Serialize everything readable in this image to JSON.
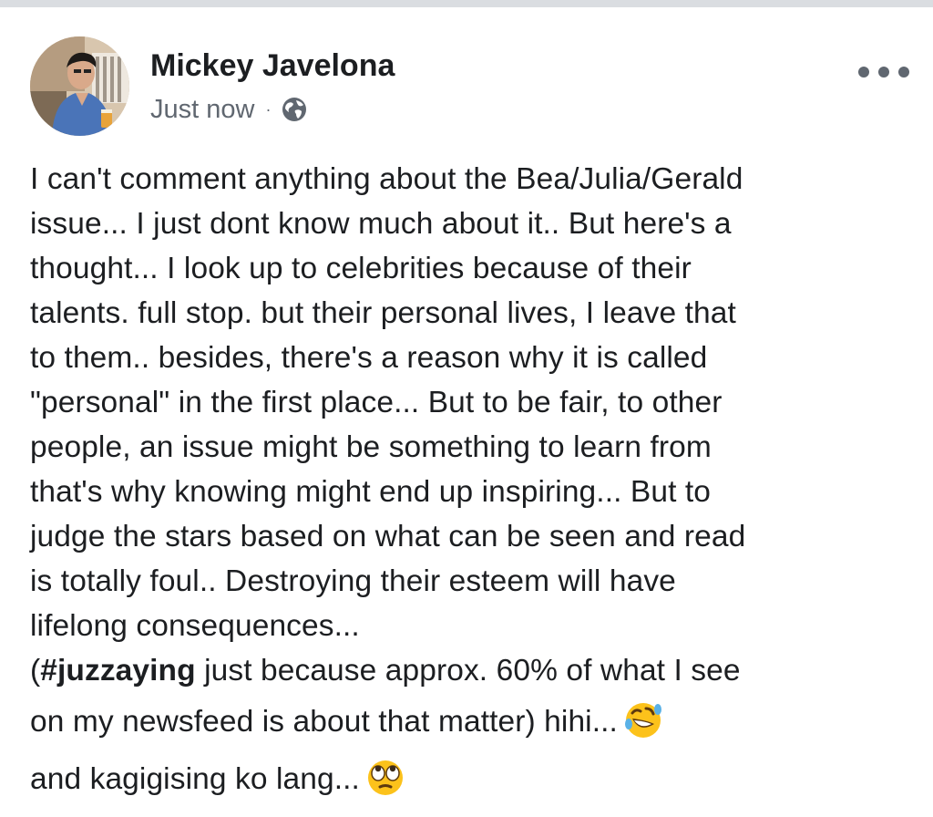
{
  "post": {
    "author_name": "Mickey Javelona",
    "timestamp": "Just now",
    "separator": "·",
    "privacy_icon": "globe-icon",
    "more_icon": "more-options-icon",
    "body": {
      "lines": [
        "I can't comment anything about the  Bea/Julia/Gerald",
        "issue... I just dont know much about  it.. But here's a",
        "thought... I look up to celebrities because of their",
        "talents. full stop. but their personal lives, I leave that",
        "to them.. besides, there's a reason why it is called",
        "\"personal\" in the first place... But to be fair, to other",
        "people, an issue might be something to learn from",
        "that's why knowing might end up inspiring... But to",
        "judge the stars based on what can be seen and read",
        "is totally foul.. Destroying their esteem will have",
        "lifelong consequences..."
      ],
      "hashtag_open": "(",
      "hashtag": "#juzzaying",
      "hashtag_rest": " just because approx. 60% of what I see",
      "line_13": "on my newsfeed is about that matter) hihi...",
      "emoji_1": "rolling-on-floor-laughing-emoji",
      "line_14": "and kagigising ko lang...",
      "emoji_2": "eye-roll-emoji"
    }
  }
}
